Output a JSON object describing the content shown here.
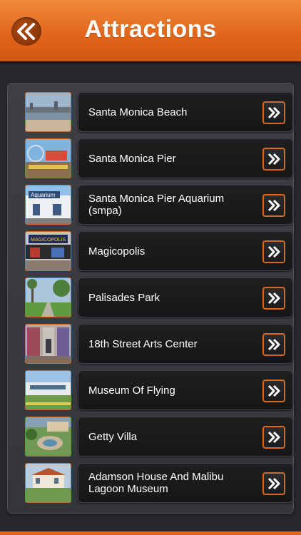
{
  "header": {
    "title": "Attractions",
    "back_icon": "double-chevron-left-icon",
    "background": "#e0651a"
  },
  "list": {
    "item_icon": "double-chevron-right-icon",
    "accent": "#d8691e",
    "items": [
      {
        "label": "Santa Monica Beach"
      },
      {
        "label": "Santa Monica Pier"
      },
      {
        "label": "Santa Monica Pier Aquarium (smpa)",
        "thumb_text": "Aquarium"
      },
      {
        "label": "Magicopolis",
        "thumb_text": "MAGICOPOLIS"
      },
      {
        "label": "Palisades Park"
      },
      {
        "label": "18th Street Arts Center"
      },
      {
        "label": "Museum Of Flying"
      },
      {
        "label": "Getty Villa"
      },
      {
        "label": "Adamson House And Malibu Lagoon Museum"
      }
    ]
  }
}
